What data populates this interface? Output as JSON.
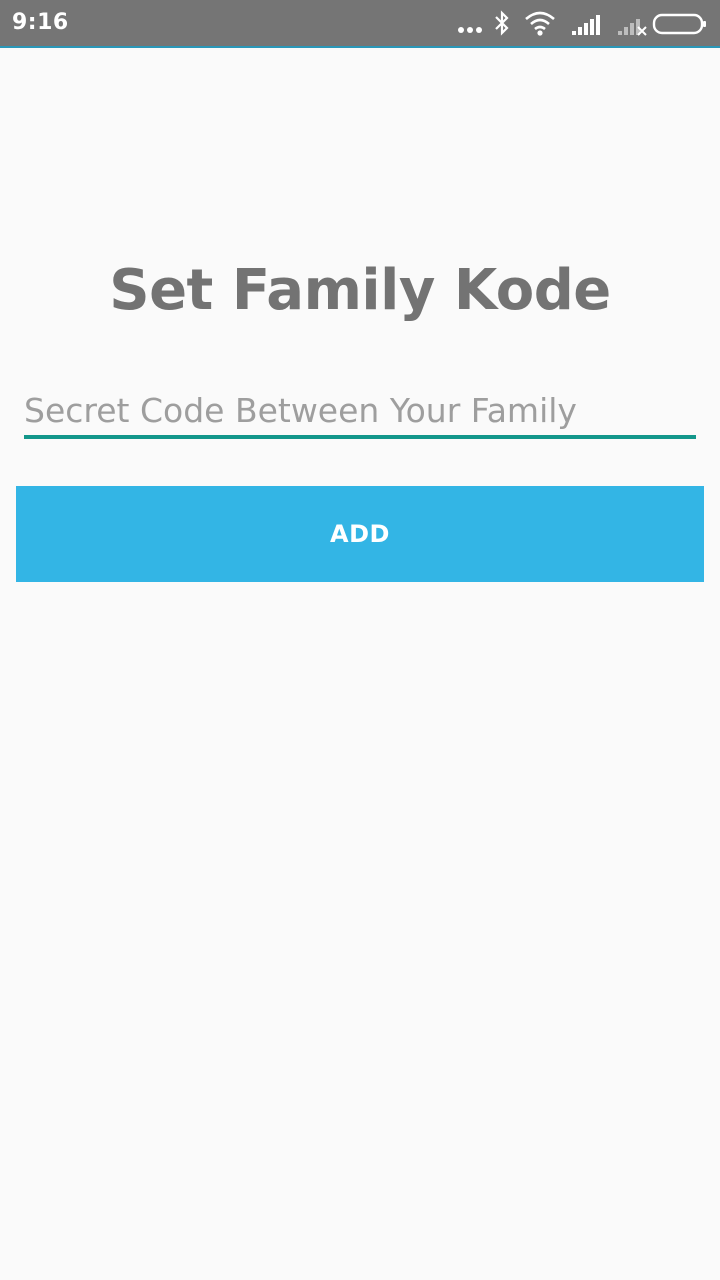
{
  "status_bar": {
    "time": "9:16",
    "icons": [
      "more-dots-icon",
      "bluetooth-icon",
      "wifi-icon",
      "signal-icon",
      "signal-no-service-icon",
      "battery-icon"
    ],
    "background_color": "#757575"
  },
  "form": {
    "title": "Set Family Kode",
    "code_input": {
      "value": "",
      "placeholder": "Secret Code Between Your Family"
    },
    "add_button_label": "ADD"
  },
  "colors": {
    "title": "#737373",
    "accent_underline": "#13978b",
    "button": "#33b5e5",
    "background": "#fafafa"
  }
}
